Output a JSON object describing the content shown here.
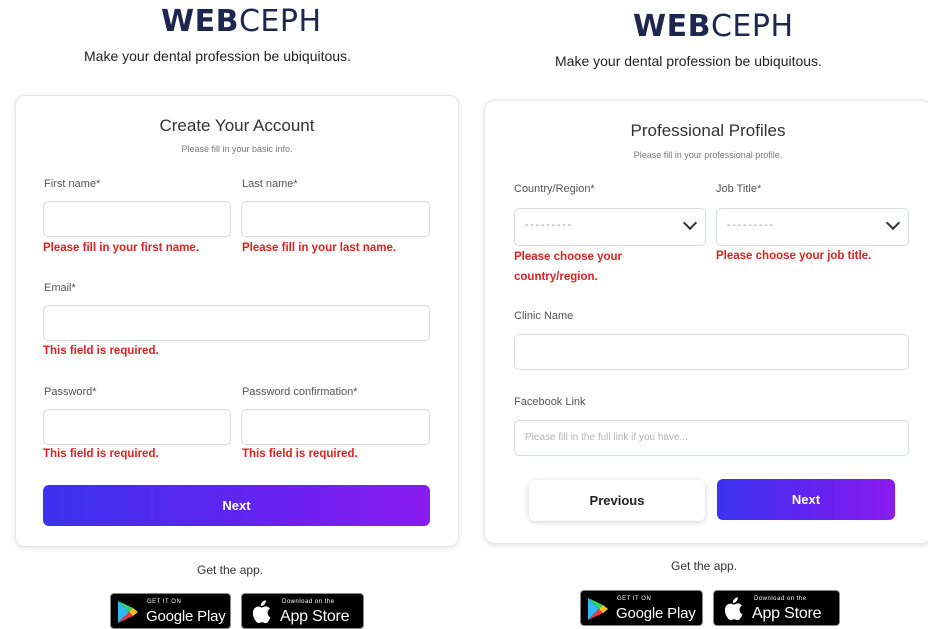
{
  "brand": {
    "logo_bold": "WEB",
    "logo_light": "CEPH",
    "tagline": "Make your dental profession be ubiquitous."
  },
  "create_account": {
    "title": "Create Your Account",
    "subtitle": "Please fill in your basic info.",
    "first_name": {
      "label": "First name*",
      "value": "",
      "error": "Please fill in your first name."
    },
    "last_name": {
      "label": "Last name*",
      "value": "",
      "error": "Please fill in your last name."
    },
    "email": {
      "label": "Email*",
      "value": "",
      "error": "This field is required."
    },
    "password": {
      "label": "Password*",
      "value": "",
      "error": "This field is required."
    },
    "password_confirmation": {
      "label": "Password confirmation*",
      "value": "",
      "error": "This field is required."
    },
    "next_label": "Next"
  },
  "professional_profiles": {
    "title": "Professional Profiles",
    "subtitle": "Please fill in your professional profile.",
    "country": {
      "label": "Country/Region*",
      "selected": "---------",
      "error": "Please choose your country/region."
    },
    "job_title": {
      "label": "Job Title*",
      "selected": "---------",
      "error": "Please choose your job title."
    },
    "clinic_name": {
      "label": "Clinic Name",
      "value": ""
    },
    "facebook_link": {
      "label": "Facebook Link",
      "placeholder": "Please fill in the full link if you have..."
    },
    "previous_label": "Previous",
    "next_label": "Next"
  },
  "app": {
    "get_the_app": "Get the app.",
    "google_play": {
      "small": "GET IT ON",
      "big": "Google Play"
    },
    "app_store": {
      "small": "Download on the",
      "big": "App Store"
    }
  },
  "colors": {
    "accent_start": "#3b33f0",
    "accent_end": "#8a1bef",
    "error": "#e02020",
    "logo": "#1d2650"
  }
}
